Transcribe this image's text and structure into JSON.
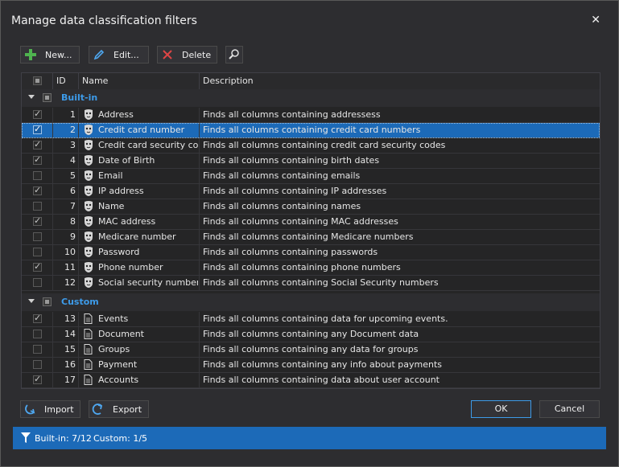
{
  "window": {
    "title": "Manage data classification filters"
  },
  "toolbar": {
    "new_label": "New...",
    "edit_label": "Edit...",
    "delete_label": "Delete"
  },
  "columns": {
    "id": "ID",
    "name": "Name",
    "description": "Description"
  },
  "groups": [
    {
      "name": "Built-in",
      "rows": [
        {
          "checked": true,
          "id": "1",
          "name": "Address",
          "description": "Finds all columns containing addressess"
        },
        {
          "checked": true,
          "id": "2",
          "name": "Credit card number",
          "description": "Finds all columns containing credit card numbers",
          "selected": true
        },
        {
          "checked": true,
          "id": "3",
          "name": "Credit card security code",
          "description": "Finds all columns containing credit card security codes"
        },
        {
          "checked": true,
          "id": "4",
          "name": "Date of Birth",
          "description": "Finds all columns containing birth dates"
        },
        {
          "checked": false,
          "id": "5",
          "name": "Email",
          "description": "Finds all columns containing emails"
        },
        {
          "checked": true,
          "id": "6",
          "name": "IP address",
          "description": "Finds all columns containing IP addresses"
        },
        {
          "checked": false,
          "id": "7",
          "name": "Name",
          "description": "Finds all columns containing names"
        },
        {
          "checked": true,
          "id": "8",
          "name": "MAC address",
          "description": "Finds all columns containing MAC addresses"
        },
        {
          "checked": false,
          "id": "9",
          "name": "Medicare number",
          "description": "Finds all columns containing Medicare numbers"
        },
        {
          "checked": false,
          "id": "10",
          "name": "Password",
          "description": "Finds all columns containing passwords"
        },
        {
          "checked": true,
          "id": "11",
          "name": "Phone number",
          "description": "Finds all columns containing phone numbers"
        },
        {
          "checked": false,
          "id": "12",
          "name": "Social security number",
          "description": "Finds all columns containing Social Security numbers"
        }
      ]
    },
    {
      "name": "Custom",
      "rows": [
        {
          "checked": true,
          "id": "13",
          "name": "Events",
          "description": "Finds all columns containing data for upcoming events."
        },
        {
          "checked": false,
          "id": "14",
          "name": "Document",
          "description": "Finds all columns containing any Document data"
        },
        {
          "checked": false,
          "id": "15",
          "name": "Groups",
          "description": "Finds all columns containing any data for groups"
        },
        {
          "checked": false,
          "id": "16",
          "name": "Payment",
          "description": "Finds all columns containing any info about payments"
        },
        {
          "checked": true,
          "id": "17",
          "name": "Accounts",
          "description": "Finds all columns containing data about user account"
        }
      ]
    }
  ],
  "footer": {
    "import_label": "Import",
    "export_label": "Export",
    "ok_label": "OK",
    "cancel_label": "Cancel"
  },
  "status": {
    "builtin": "Built-in: 7/12",
    "custom": "Custom: 1/5"
  },
  "colors": {
    "accent": "#3d9be9",
    "selection": "#1c6ab8",
    "background": "#2d2d30"
  },
  "icons": {
    "new": "plus-icon",
    "edit": "pencil-icon",
    "delete": "x-icon",
    "search": "magnifier-icon",
    "import": "import-arrow-icon",
    "export": "export-arrow-icon",
    "status": "filter-icon",
    "builtin_row": "mask-icon",
    "custom_row": "document-icon"
  }
}
